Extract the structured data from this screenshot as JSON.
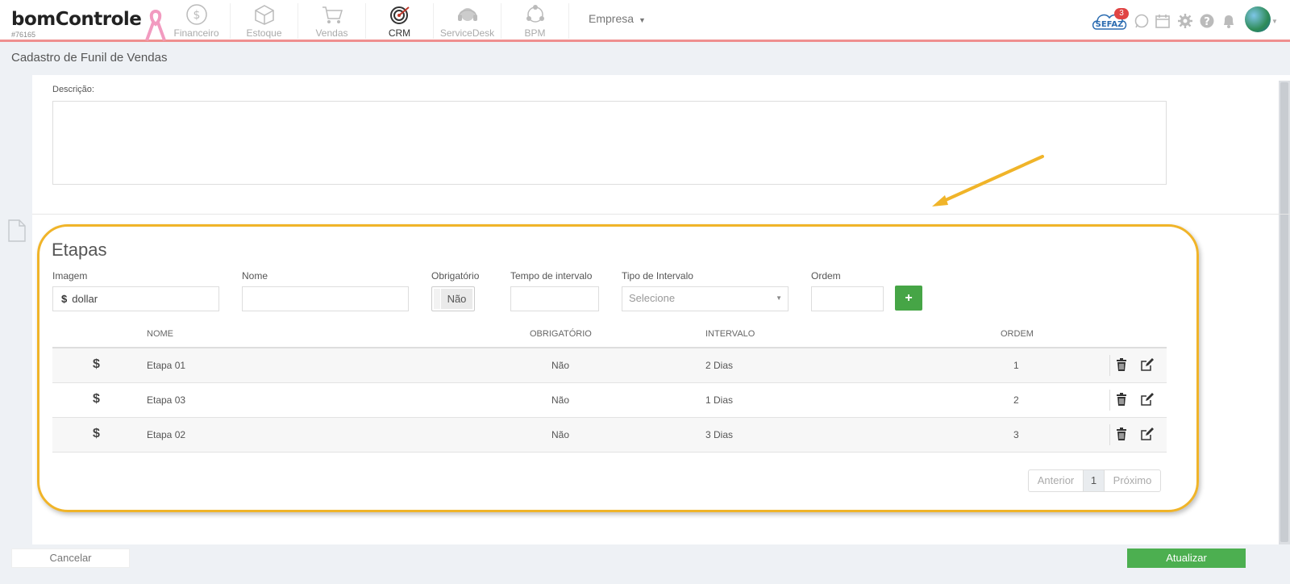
{
  "header": {
    "logo": "bomControle",
    "account_id": "#76165",
    "modules": [
      {
        "label": "Financeiro",
        "icon": "dollar-circle-icon"
      },
      {
        "label": "Estoque",
        "icon": "box-icon"
      },
      {
        "label": "Vendas",
        "icon": "cart-icon"
      },
      {
        "label": "CRM",
        "icon": "target-icon"
      },
      {
        "label": "ServiceDesk",
        "icon": "headset-icon"
      },
      {
        "label": "BPM",
        "icon": "network-icon"
      }
    ],
    "empresa": "Empresa",
    "sefaz": "SEFAZ",
    "sefaz_badge": "3"
  },
  "page": {
    "title": "Cadastro de Funil de Vendas",
    "descricao_label": "Descrição:"
  },
  "etapas": {
    "title": "Etapas",
    "labels": {
      "imagem": "Imagem",
      "nome": "Nome",
      "obrigatorio": "Obrigatório",
      "tempo": "Tempo de intervalo",
      "tipo": "Tipo de Intervalo",
      "ordem": "Ordem"
    },
    "imagem_value": "dollar",
    "obrigatorio_value": "Não",
    "tipo_placeholder": "Selecione",
    "add_label": "+",
    "columns": {
      "nome": "NOME",
      "obrigatorio": "OBRIGATÓRIO",
      "intervalo": "INTERVALO",
      "ordem": "ORDEM"
    },
    "rows": [
      {
        "icon": "$",
        "nome": "Etapa 01",
        "obrigatorio": "Não",
        "intervalo": "2 Dias",
        "ordem": "1"
      },
      {
        "icon": "$",
        "nome": "Etapa 03",
        "obrigatorio": "Não",
        "intervalo": "1 Dias",
        "ordem": "2"
      },
      {
        "icon": "$",
        "nome": "Etapa 02",
        "obrigatorio": "Não",
        "intervalo": "3 Dias",
        "ordem": "3"
      }
    ]
  },
  "pagination": {
    "prev": "Anterior",
    "current": "1",
    "next": "Próximo"
  },
  "footer": {
    "cancel": "Cancelar",
    "save": "Atualizar"
  },
  "colors": {
    "accent_red": "#ef8f8f",
    "highlight": "#f0b429",
    "save_green": "#4caf50"
  }
}
